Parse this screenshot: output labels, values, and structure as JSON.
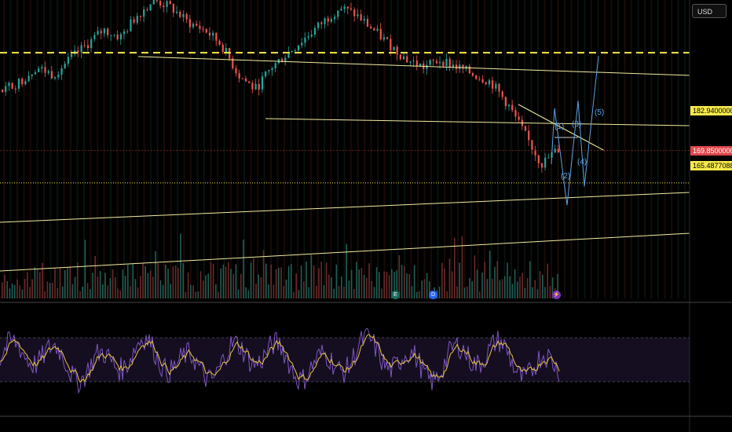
{
  "currency_button": "USD",
  "price_tags": {
    "upper_level": "182.94000000",
    "current_price": "169.85000000",
    "lower_level": "165.48770880"
  },
  "wave_labels": [
    "(1)",
    "(2)",
    "(3)",
    "(4)",
    "(5)"
  ],
  "event_badges": [
    "E",
    "D"
  ],
  "lightning_badge": "⚡",
  "colors": {
    "background": "#000000",
    "trendline": "#f2eba0",
    "dashed_level": "#f6e94a",
    "wave_projection": "#5ea2e6",
    "candle_up": "#26a69a",
    "candle_down": "#ef5350",
    "rsi_line": "#7e57c2",
    "rsi_ma": "#e8c542"
  },
  "chart_data": {
    "type": "line",
    "price_axis": {
      "ylim": [
        150,
        190
      ]
    },
    "horizontal_levels": [
      182.94,
      169.85,
      165.4877088
    ],
    "price_series_approx": [
      178,
      179,
      181,
      180,
      182,
      184,
      186,
      185,
      188,
      190,
      189,
      187,
      186,
      184,
      180,
      178,
      181,
      183,
      185,
      187,
      189,
      188,
      186,
      184,
      182,
      181,
      182,
      181,
      180,
      179,
      176,
      172,
      168,
      170
    ],
    "elliott_wave_projection": {
      "labels": [
        "(1)",
        "(2)",
        "(3)",
        "(4)",
        "(5)"
      ],
      "values": [
        175.5,
        162.5,
        176.5,
        165,
        182.5
      ]
    },
    "rsi": {
      "ylim": [
        0,
        100
      ],
      "upper_band": 70,
      "lower_band": 30
    }
  }
}
